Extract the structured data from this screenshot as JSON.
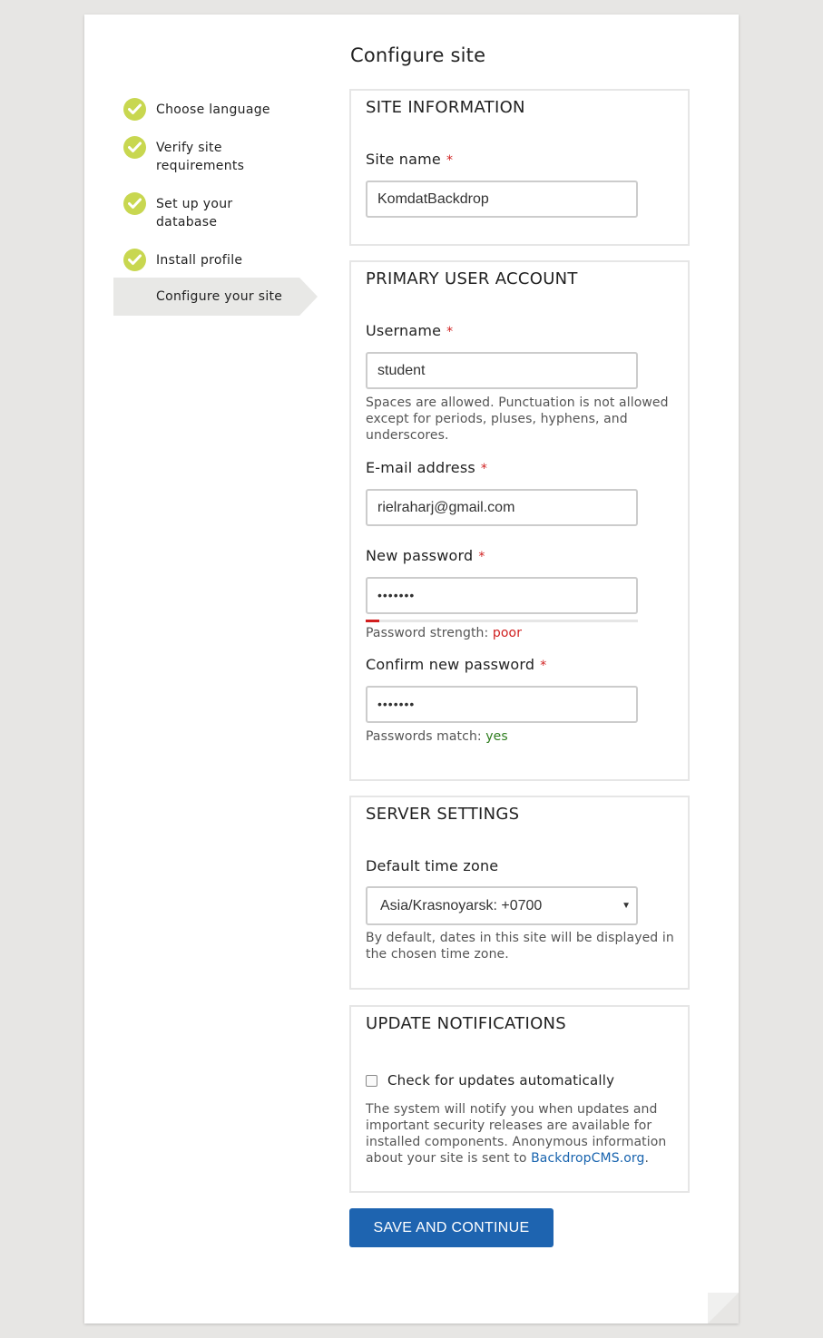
{
  "title": "Configure site",
  "steps": [
    {
      "label": "Choose language",
      "done": true
    },
    {
      "label": "Verify site requirements",
      "done": true
    },
    {
      "label": "Set up your database",
      "done": true
    },
    {
      "label": "Install profile",
      "done": true
    },
    {
      "label": "Configure your site",
      "done": false,
      "active": true
    }
  ],
  "site_info": {
    "legend": "SITE INFORMATION",
    "site_name_label": "Site name",
    "site_name_value": "KomdatBackdrop"
  },
  "account": {
    "legend": "PRIMARY USER ACCOUNT",
    "username_label": "Username",
    "username_value": "student",
    "username_desc": "Spaces are allowed. Punctuation is not allowed except for periods, pluses, hyphens, and underscores.",
    "email_label": "E-mail address",
    "email_value": "rielraharj@gmail.com",
    "password_label": "New password",
    "password_value": "•••••••",
    "strength_label": "Password strength:",
    "strength_value": "poor",
    "strength_fraction": 0.05,
    "confirm_label": "Confirm new password",
    "confirm_value": "•••••••",
    "match_label": "Passwords match:",
    "match_value": "yes"
  },
  "server": {
    "legend": "SERVER SETTINGS",
    "tz_label": "Default time zone",
    "tz_value": "Asia/Krasnoyarsk: +0700",
    "tz_desc": "By default, dates in this site will be displayed in the chosen time zone."
  },
  "updates": {
    "legend": "UPDATE NOTIFICATIONS",
    "checkbox_label": "Check for updates automatically",
    "checked": false,
    "desc": "The system will notify you when updates and important security releases are available for installed components. Anonymous information about your site is sent to",
    "link_text": "BackdropCMS.org",
    "desc_end": "."
  },
  "required_marker": "*",
  "submit_label": "SAVE AND CONTINUE",
  "colors": {
    "background": "#e7e6e4",
    "check": "#c8d750",
    "accent": "#1e64b0",
    "error": "#d02020",
    "success": "#2e7d1e"
  }
}
